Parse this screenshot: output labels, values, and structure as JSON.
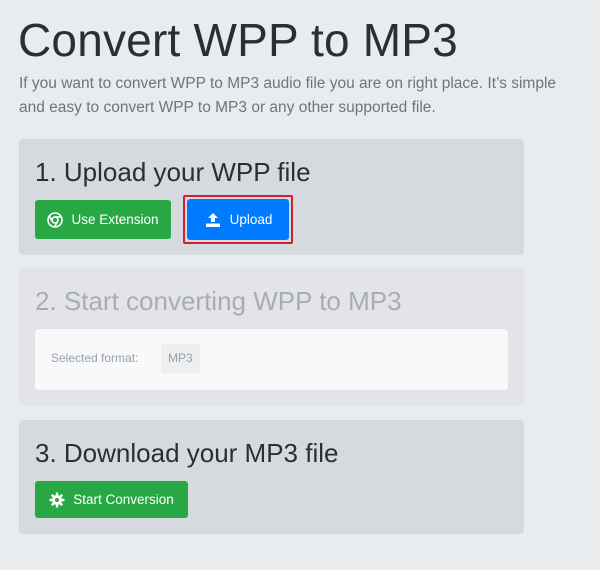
{
  "header": {
    "title": "Convert WPP to MP3",
    "description": "If you want to convert WPP to MP3 audio file you are on right place. It’s simple and easy to convert WPP to MP3 or any other supported file."
  },
  "step1": {
    "title": "1. Upload your WPP file",
    "extension_label": "Use Extension",
    "upload_label": "Upload"
  },
  "step2": {
    "title": "2. Start converting WPP to MP3",
    "format_label": "Selected format:",
    "format_value": "MP3"
  },
  "step3": {
    "title": "3. Download your MP3 file",
    "start_label": "Start Conversion"
  },
  "icons": {
    "extension": "chrome-icon",
    "upload": "upload-icon",
    "start": "gear-icon"
  },
  "colors": {
    "green": "#28a745",
    "blue": "#007bff",
    "highlight": "#d0202a"
  }
}
